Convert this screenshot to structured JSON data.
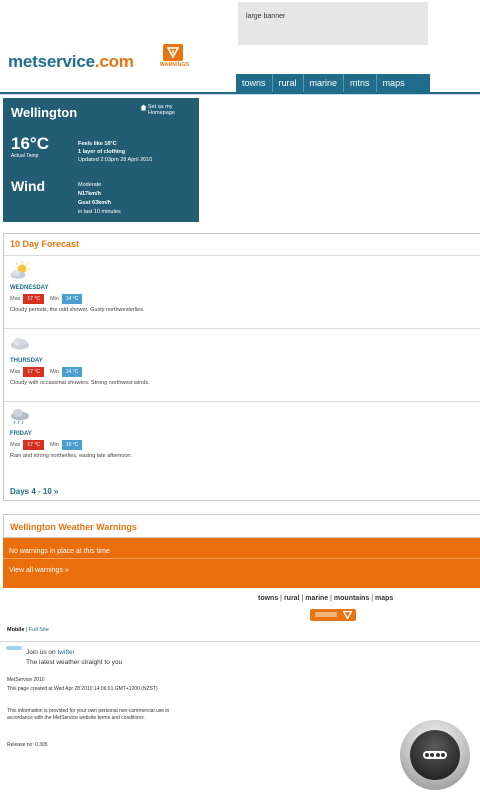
{
  "banner": {
    "text": "large banner"
  },
  "logo": {
    "part1": "metservice",
    "part2": ".com"
  },
  "warn_logo": {
    "text": "WARNINGS",
    "color": "#e87511"
  },
  "nav": {
    "items": [
      "towns",
      "rural",
      "marine",
      "mtns",
      "maps"
    ]
  },
  "current": {
    "city": "Wellington",
    "set_home": [
      "Set as my",
      "Homepage"
    ],
    "temp": "16°C",
    "temp_label": "Actual Temp",
    "feels_like": "Feels like 16°C",
    "clothing": "1 layer of clothing",
    "updated": "Updated 2:03pm 28 April 2010",
    "wind_heading": "Wind",
    "wind_strength": "Moderate",
    "wind_speed": "N17km/h",
    "gust": "Gust 63km/h",
    "wind_period": "in last 10 minutes"
  },
  "forecast": {
    "title": "10 Day Forecast",
    "max_label": "Max",
    "min_label": "Min",
    "days": [
      {
        "name": "WEDNESDAY",
        "icon": "sun-cloud-icon",
        "max": "17 °C",
        "min": "14 °C",
        "desc": "Cloudy periods, the odd shower. Gusty northwesterlies."
      },
      {
        "name": "THURSDAY",
        "icon": "cloud-icon",
        "max": "17 °C",
        "min": "14 °C",
        "desc": "Cloudy with occasional showers. Strong northwest winds."
      },
      {
        "name": "FRIDAY",
        "icon": "rain-cloud-icon",
        "max": "17 °C",
        "min": "10 °C",
        "desc": "Rain and strong northerlies, easing late afternoon."
      }
    ],
    "more_link": "Days 4 - 10 »"
  },
  "warnings": {
    "title": "Wellington Weather Warnings",
    "none": "No warnings in place at this time",
    "view_all": "View all warnings »",
    "bg_color": "#ea6e0b"
  },
  "footer": {
    "nav": [
      "towns",
      "rural",
      "marine",
      "mountains",
      "maps"
    ],
    "mobile": "Mobile",
    "full_site": "Full Site",
    "join_prefix": "Join us on ",
    "twitter": "twitter",
    "tagline": "The latest weather straight to you",
    "copyright": "MetService 2010",
    "created": "This page created at Wed Apr 28 2010 14:06:01 GMT+1200 (NZST)",
    "disclaimer": "This information is provided for your own personal non-commercial use in accordance with the MetService website terms and conditions.",
    "release": "Release no: 0.305"
  },
  "colors": {
    "brand_blue": "#1f6c8b",
    "brand_orange": "#e87511",
    "panel_dark": "#225d74",
    "max_red": "#d6321f",
    "min_blue": "#4a9fd0"
  }
}
